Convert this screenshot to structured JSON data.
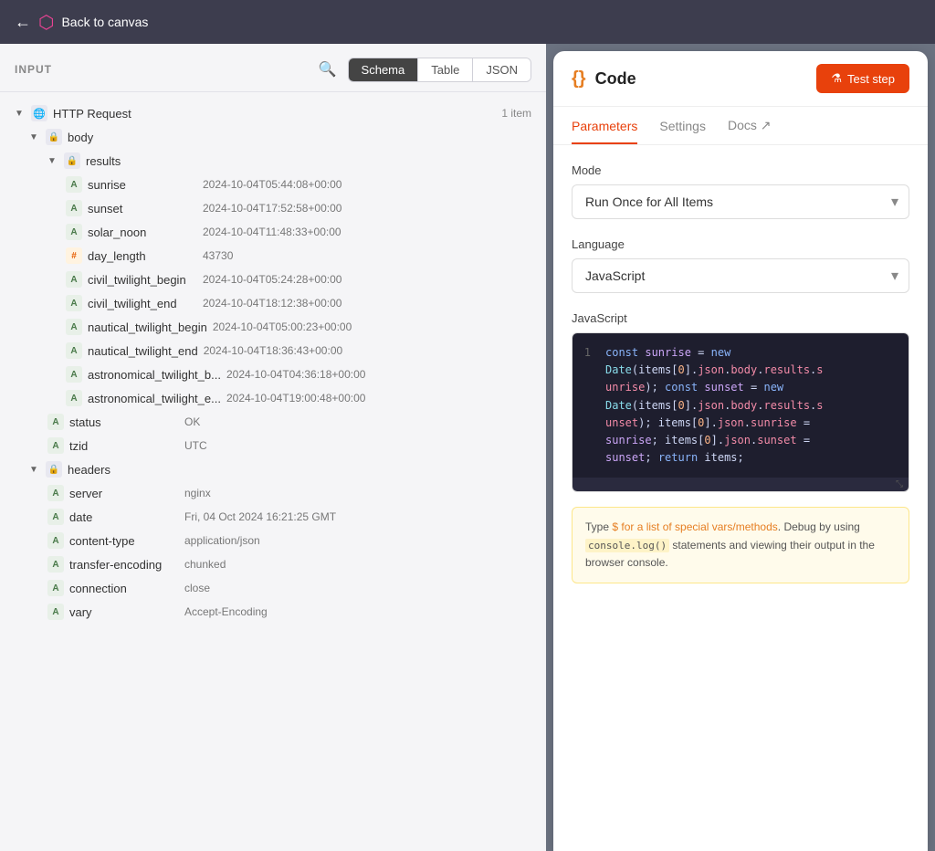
{
  "topbar": {
    "back_label": "Back to canvas",
    "logo": "n8n"
  },
  "left_panel": {
    "input_label": "INPUT",
    "tabs": [
      "Schema",
      "Table",
      "JSON"
    ],
    "active_tab": "Schema",
    "tree": {
      "root": {
        "name": "HTTP Request",
        "count": "1 item",
        "children": {
          "body": {
            "name": "body",
            "children": {
              "results": {
                "name": "results",
                "items": [
                  {
                    "type": "A",
                    "name": "sunrise",
                    "value": "2024-10-04T05:44:08+00:00"
                  },
                  {
                    "type": "A",
                    "name": "sunset",
                    "value": "2024-10-04T17:52:58+00:00"
                  },
                  {
                    "type": "A",
                    "name": "solar_noon",
                    "value": "2024-10-04T11:48:33+00:00"
                  },
                  {
                    "type": "#",
                    "name": "day_length",
                    "value": "43730"
                  },
                  {
                    "type": "A",
                    "name": "civil_twilight_begin",
                    "value": "2024-10-04T05:24:28+00:00"
                  },
                  {
                    "type": "A",
                    "name": "civil_twilight_end",
                    "value": "2024-10-04T18:12:38+00:00"
                  },
                  {
                    "type": "A",
                    "name": "nautical_twilight_begin",
                    "value": "2024-10-04T05:00:23+00:00"
                  },
                  {
                    "type": "A",
                    "name": "nautical_twilight_end",
                    "value": "2024-10-04T18:36:43+00:00"
                  },
                  {
                    "type": "A",
                    "name": "astronomical_twilight_b...",
                    "value": "2024-10-04T04:36:18+00:00"
                  },
                  {
                    "type": "A",
                    "name": "astronomical_twilight_e...",
                    "value": "2024-10-04T19:00:48+00:00"
                  }
                ]
              },
              "status": {
                "type": "A",
                "name": "status",
                "value": "OK"
              },
              "tzid": {
                "type": "A",
                "name": "tzid",
                "value": "UTC"
              }
            }
          },
          "headers": {
            "name": "headers",
            "items": [
              {
                "type": "A",
                "name": "server",
                "value": "nginx"
              },
              {
                "type": "A",
                "name": "date",
                "value": "Fri, 04 Oct 2024 16:21:25 GMT"
              },
              {
                "type": "A",
                "name": "content-type",
                "value": "application/json"
              },
              {
                "type": "A",
                "name": "transfer-encoding",
                "value": "chunked"
              },
              {
                "type": "A",
                "name": "connection",
                "value": "close"
              },
              {
                "type": "A",
                "name": "vary",
                "value": "Accept-Encoding"
              }
            ]
          }
        }
      }
    }
  },
  "right_panel": {
    "title": "Code",
    "test_step_label": "Test step",
    "tabs": [
      "Parameters",
      "Settings",
      "Docs"
    ],
    "active_tab": "Parameters",
    "mode_label": "Mode",
    "mode_value": "Run Once for All Items",
    "language_label": "Language",
    "language_value": "JavaScript",
    "code_label": "JavaScript",
    "code_line_number": "1",
    "code_content": "const sunrise = new Date(items[0].json.body.results.sunrise); const sunset = new Date(items[0].json.body.results.sunset); items[0].json.sunrise = sunrise; items[0].json.sunset = sunset; return items;",
    "hint_text_prefix": "Type ",
    "hint_special": "$ for a list of special vars/methods",
    "hint_text_middle": ". Debug by using ",
    "hint_mono": "console.log()",
    "hint_text_suffix": " statements and viewing their output in the browser console.",
    "docs_label": "Docs ↗"
  }
}
